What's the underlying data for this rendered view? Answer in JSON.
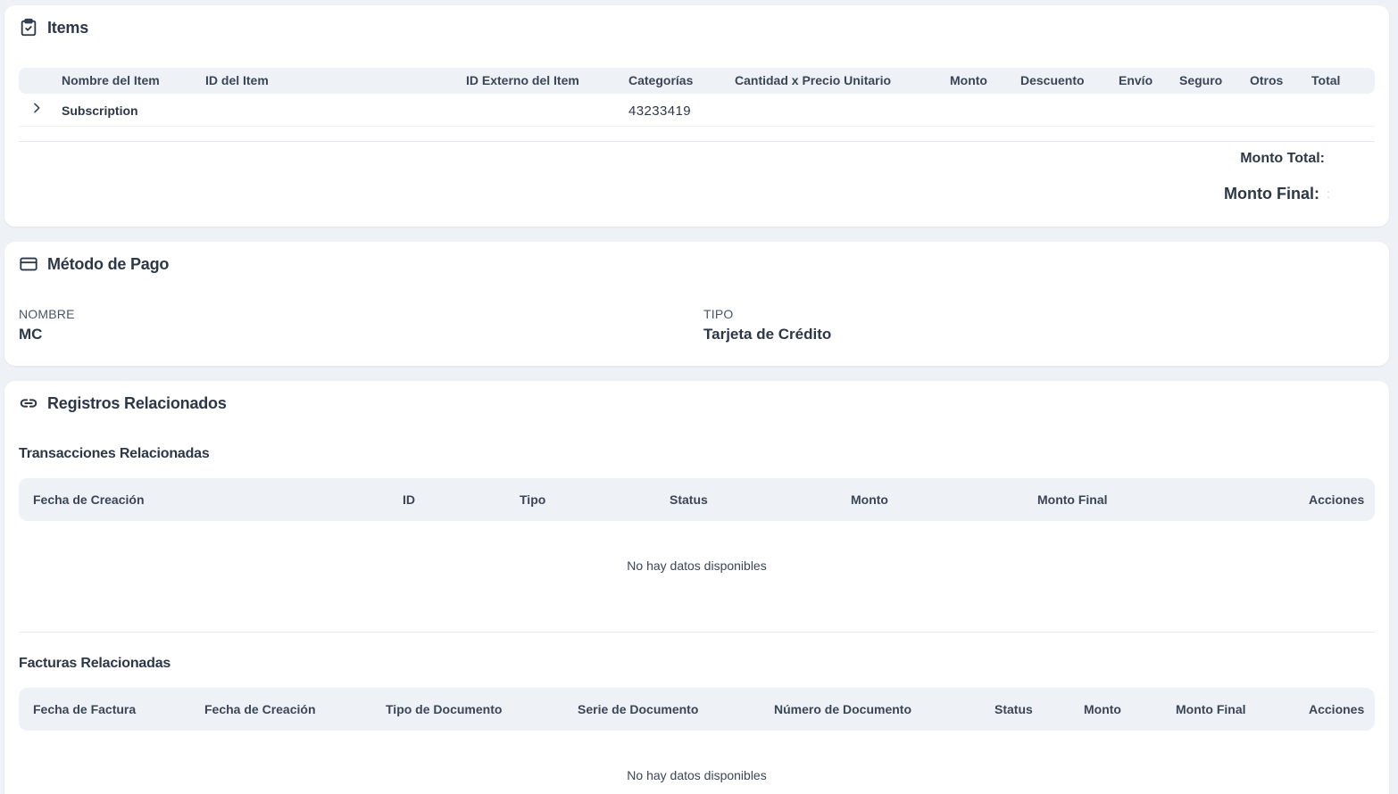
{
  "items_card": {
    "title": "Items",
    "icon": "clipboard-check-icon",
    "columns": [
      "Nombre del Item",
      "ID del Item",
      "ID Externo del Item",
      "Categorías",
      "Cantidad x Precio Unitario",
      "Monto",
      "Descuento",
      "Envío",
      "Seguro",
      "Otros",
      "Total"
    ],
    "rows": [
      {
        "name": "Subscription",
        "id": "",
        "external_id": "",
        "category": "43233419",
        "qty_price": "",
        "amount": "",
        "discount": "",
        "shipping": "",
        "insurance": "",
        "others": "",
        "total": ""
      }
    ],
    "monto_total_label": "Monto Total:",
    "monto_final_label": "Monto Final:",
    "monto_final_value": ":"
  },
  "payment_card": {
    "title": "Método de Pago",
    "icon": "credit-card-icon",
    "name_label": "NOMBRE",
    "name_value": "MC",
    "type_label": "TIPO",
    "type_value": "Tarjeta de Crédito"
  },
  "related_card": {
    "title": "Registros Relacionados",
    "icon": "link-icon",
    "transactions": {
      "title": "Transacciones Relacionadas",
      "columns": [
        "Fecha de Creación",
        "ID",
        "Tipo",
        "Status",
        "Monto",
        "Monto Final",
        "Acciones"
      ],
      "empty_message": "No hay datos disponibles"
    },
    "invoices": {
      "title": "Facturas Relacionadas",
      "columns": [
        "Fecha de Factura",
        "Fecha de Creación",
        "Tipo de Documento",
        "Serie de Documento",
        "Número de Documento",
        "Status",
        "Monto",
        "Monto Final",
        "Acciones"
      ],
      "empty_message": "No hay datos disponibles"
    }
  }
}
